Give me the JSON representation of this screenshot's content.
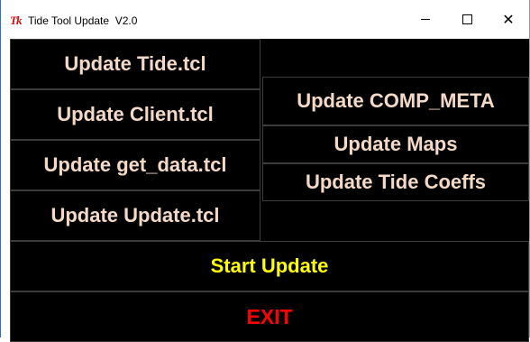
{
  "window": {
    "icon_glyph": "Tk",
    "icon_name": "tk-feather-icon",
    "title": "Tide Tool Update  V2.0",
    "minimize_glyph": "",
    "close_glyph": "✕"
  },
  "colors": {
    "background": "#000000",
    "label_peach": "#f3d9c6",
    "start_yellow": "#ffff00",
    "exit_red": "#ff0000"
  },
  "buttons": {
    "update_tide": "Update Tide.tcl",
    "update_client": "Update Client.tcl",
    "update_get_data": "Update get_data.tcl",
    "update_update": "Update Update.tcl",
    "update_comp_meta": "Update COMP_META",
    "update_maps": "Update Maps",
    "update_tide_coeffs": "Update Tide Coeffs",
    "start_update": "Start Update",
    "exit": "EXIT"
  }
}
